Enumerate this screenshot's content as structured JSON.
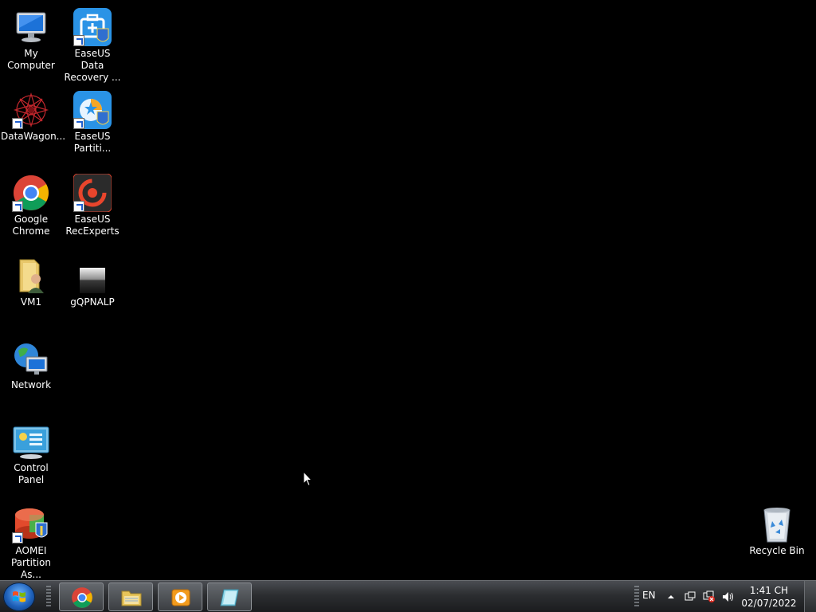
{
  "desktop": {
    "icons": [
      {
        "name": "my-computer",
        "label": "My Computer",
        "shortcut": false
      },
      {
        "name": "easeus-data-recovery",
        "label": "EaseUS Data Recovery ...",
        "shortcut": true
      },
      {
        "name": "datawagon",
        "label": "DataWagon...",
        "shortcut": true
      },
      {
        "name": "easeus-partition",
        "label": "EaseUS Partiti...",
        "shortcut": true
      },
      {
        "name": "google-chrome",
        "label": "Google Chrome",
        "shortcut": true
      },
      {
        "name": "easeus-recexperts",
        "label": "EaseUS RecExperts",
        "shortcut": true
      },
      {
        "name": "vm1",
        "label": "VM1",
        "shortcut": false
      },
      {
        "name": "gqpnalp",
        "label": "gQPNALP",
        "shortcut": false
      },
      {
        "name": "network",
        "label": "Network",
        "shortcut": false
      },
      {
        "name": "control-panel",
        "label": "Control Panel",
        "shortcut": false
      },
      {
        "name": "aomei-partition",
        "label": "AOMEI Partition As...",
        "shortcut": true
      },
      {
        "name": "recycle-bin",
        "label": "Recycle Bin",
        "shortcut": false
      }
    ]
  },
  "taskbar": {
    "pinned": [
      {
        "name": "chrome-taskbar-button",
        "icon": "chrome-icon",
        "active": true
      },
      {
        "name": "explorer-taskbar-button",
        "icon": "folder-icon",
        "active": false
      },
      {
        "name": "media-player-taskbar-button",
        "icon": "media-player-icon",
        "active": false
      },
      {
        "name": "snipping-taskbar-button",
        "icon": "snipping-tool-icon",
        "active": true
      }
    ],
    "tray": {
      "language": "EN",
      "time": "1:41 CH",
      "date": "02/07/2022"
    }
  }
}
